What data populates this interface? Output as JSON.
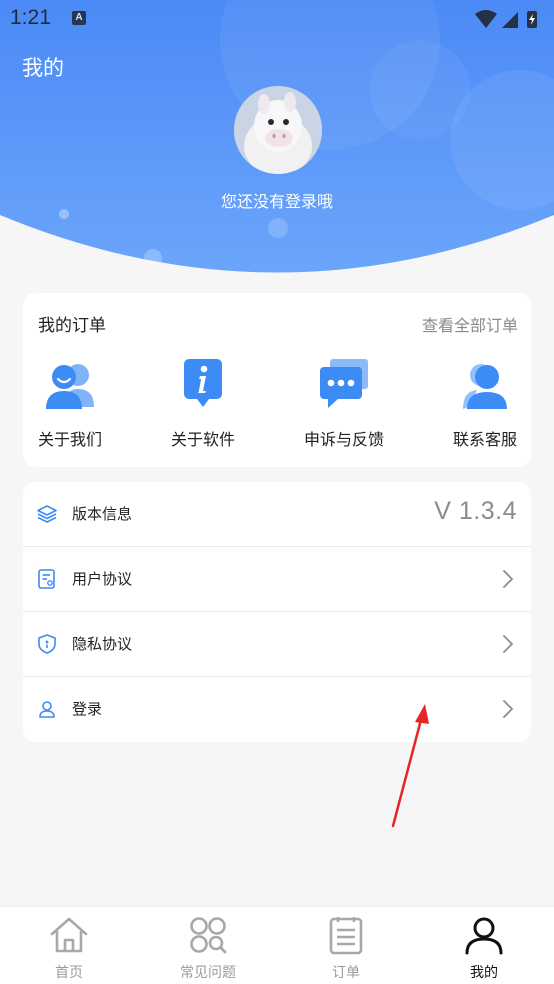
{
  "status_bar": {
    "time": "1:21",
    "notification_badge": "A"
  },
  "header": {
    "title": "我的",
    "login_hint": "您还没有登录哦",
    "gradient_top": "#4a8cf7",
    "gradient_bottom": "#6aa6fb"
  },
  "orders": {
    "title": "我的订单",
    "view_all": "查看全部订单",
    "shortcuts": [
      {
        "label": "关于我们",
        "icon": "users-icon"
      },
      {
        "label": "关于软件",
        "icon": "info-icon"
      },
      {
        "label": "申诉与反馈",
        "icon": "chat-icon"
      },
      {
        "label": "联系客服",
        "icon": "customer-service-icon"
      }
    ]
  },
  "menu": [
    {
      "label": "版本信息",
      "value": "V 1.3.4",
      "icon": "layers-icon"
    },
    {
      "label": "用户协议",
      "icon": "document-icon"
    },
    {
      "label": "隐私协议",
      "icon": "shield-icon"
    },
    {
      "label": "登录",
      "icon": "user-icon"
    }
  ],
  "bottom_nav": [
    {
      "label": "首页",
      "icon": "home-icon",
      "active": false
    },
    {
      "label": "常见问题",
      "icon": "faq-icon",
      "active": false
    },
    {
      "label": "订单",
      "icon": "order-icon",
      "active": false
    },
    {
      "label": "我的",
      "icon": "profile-icon",
      "active": true
    }
  ],
  "colors": {
    "accent": "#3b8cf5",
    "annotation_arrow": "#e82424"
  }
}
